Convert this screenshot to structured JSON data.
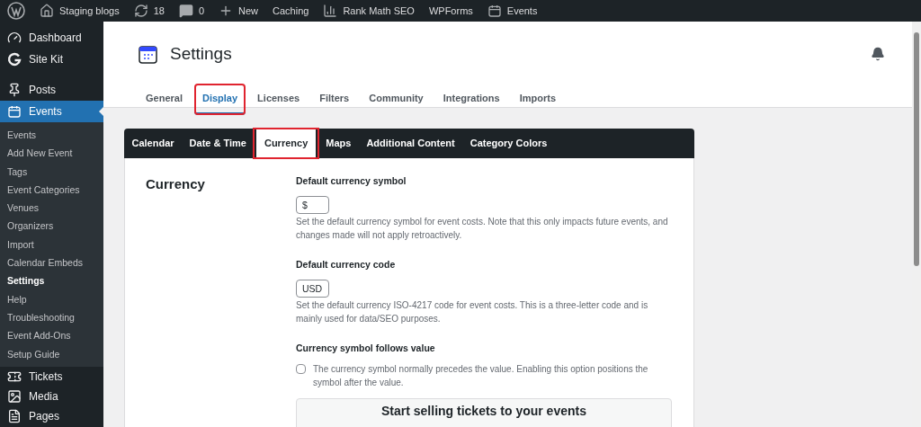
{
  "admin_bar": {
    "items": [
      {
        "kind": "wp"
      },
      {
        "kind": "home",
        "label": "Staging blogs"
      },
      {
        "kind": "updates",
        "label": "18"
      },
      {
        "kind": "comments",
        "label": "0"
      },
      {
        "kind": "new",
        "label": "New"
      },
      {
        "kind": "text",
        "label": "Caching"
      },
      {
        "kind": "rankmath",
        "label": "Rank Math SEO"
      },
      {
        "kind": "text",
        "label": "WPForms"
      },
      {
        "kind": "events",
        "label": "Events"
      }
    ]
  },
  "sidebar": {
    "items": [
      {
        "kind": "dashboard",
        "label": "Dashboard",
        "selected": false
      },
      {
        "kind": "sitekit",
        "label": "Site Kit",
        "selected": false
      },
      {
        "kind": "posts",
        "label": "Posts",
        "selected": false
      },
      {
        "kind": "events",
        "label": "Events",
        "selected": true,
        "children": [
          {
            "label": "Events",
            "selected": false
          },
          {
            "label": "Add New Event",
            "selected": false
          },
          {
            "label": "Tags",
            "selected": false
          },
          {
            "label": "Event Categories",
            "selected": false
          },
          {
            "label": "Venues",
            "selected": false
          },
          {
            "label": "Organizers",
            "selected": false
          },
          {
            "label": "Import",
            "selected": false
          },
          {
            "label": "Calendar Embeds",
            "selected": false
          },
          {
            "label": "Settings",
            "selected": true
          },
          {
            "label": "Help",
            "selected": false
          },
          {
            "label": "Troubleshooting",
            "selected": false
          },
          {
            "label": "Event Add-Ons",
            "selected": false
          },
          {
            "label": "Setup Guide",
            "selected": false
          }
        ]
      },
      {
        "kind": "tickets",
        "label": "Tickets",
        "selected": false
      },
      {
        "kind": "media",
        "label": "Media",
        "selected": false
      },
      {
        "kind": "pages",
        "label": "Pages",
        "selected": false
      }
    ]
  },
  "header": {
    "title": "Settings"
  },
  "tabs": [
    {
      "label": "General",
      "selected": false,
      "highlighted": false
    },
    {
      "label": "Display",
      "selected": true,
      "highlighted": true
    },
    {
      "label": "Licenses",
      "selected": false,
      "highlighted": false
    },
    {
      "label": "Filters",
      "selected": false,
      "highlighted": false
    },
    {
      "label": "Community",
      "selected": false,
      "highlighted": false
    },
    {
      "label": "Integrations",
      "selected": false,
      "highlighted": false
    },
    {
      "label": "Imports",
      "selected": false,
      "highlighted": false
    }
  ],
  "subtabs": [
    {
      "label": "Calendar",
      "selected": false,
      "highlighted": false
    },
    {
      "label": "Date & Time",
      "selected": false,
      "highlighted": false
    },
    {
      "label": "Currency",
      "selected": true,
      "highlighted": true
    },
    {
      "label": "Maps",
      "selected": false,
      "highlighted": false
    },
    {
      "label": "Additional Content",
      "selected": false,
      "highlighted": false
    },
    {
      "label": "Category Colors",
      "selected": false,
      "highlighted": false
    }
  ],
  "section": {
    "title": "Currency",
    "fields": [
      {
        "kind": "text",
        "label": "Default currency symbol",
        "value": "$",
        "help": "Set the default currency symbol for event costs. Note that this only impacts future events, and changes made will not apply retroactively."
      },
      {
        "kind": "text",
        "label": "Default currency code",
        "value": "USD",
        "help": "Set the default currency ISO-4217 code for event costs. This is a three-letter code and is mainly used for data/SEO purposes."
      },
      {
        "kind": "checkbox",
        "label": "Currency symbol follows value",
        "checked": false,
        "help": "The currency symbol normally precedes the value. Enabling this option positions the symbol after the value."
      }
    ]
  },
  "promo": {
    "title": "Start selling tickets to your events"
  }
}
